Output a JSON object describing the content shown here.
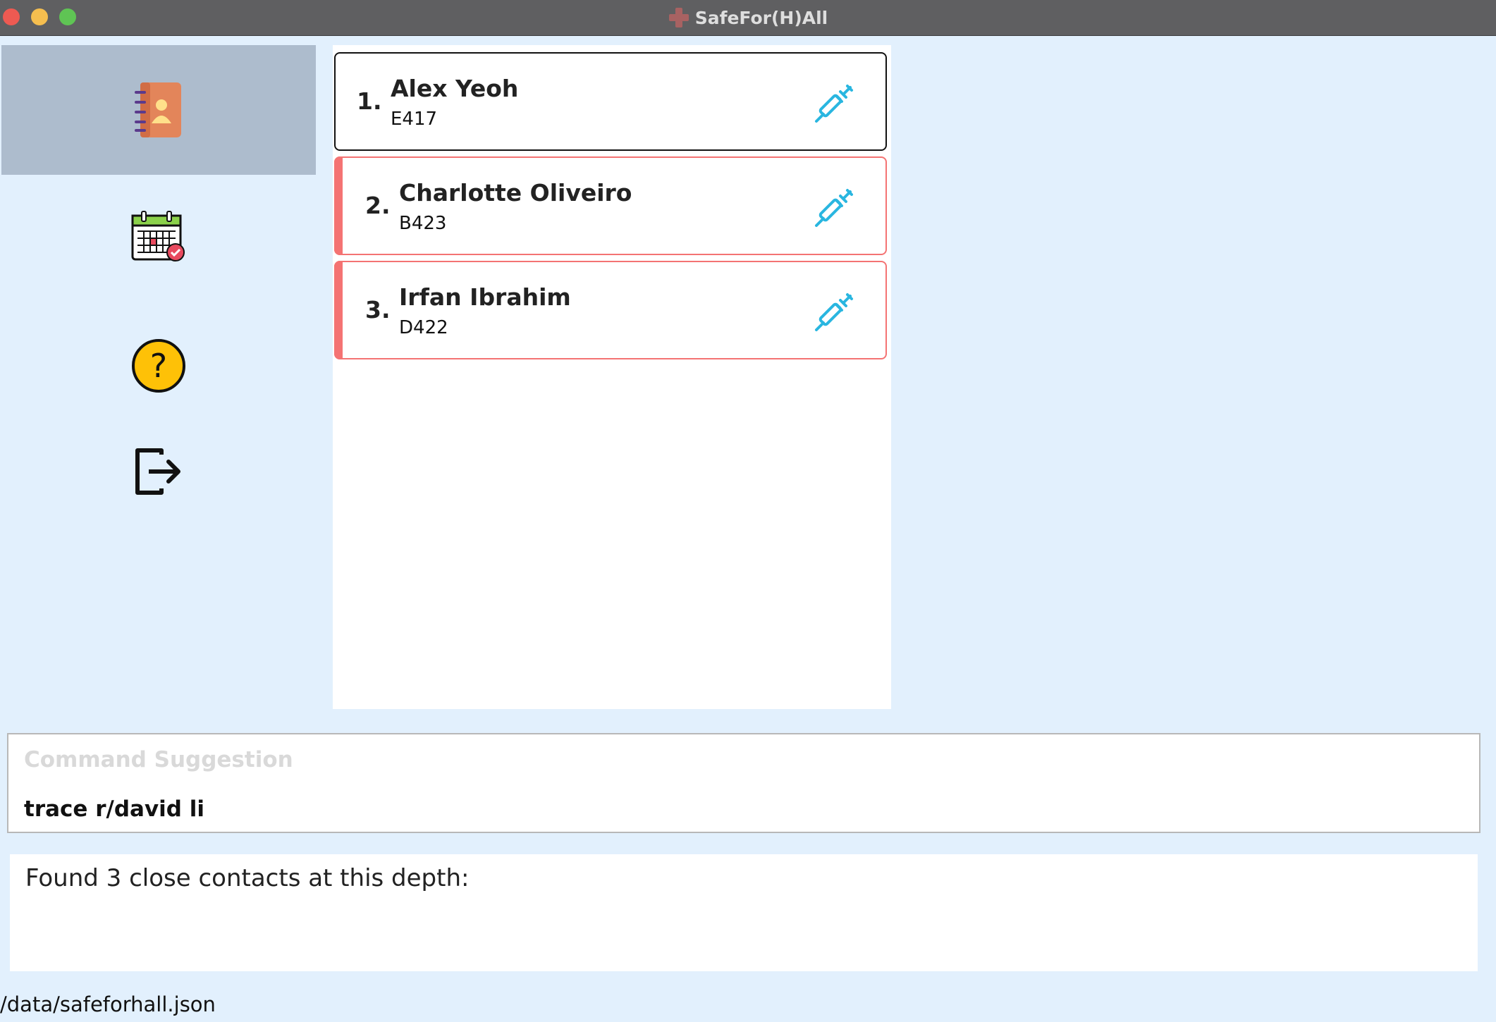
{
  "window": {
    "title": "SafeFor(H)All",
    "logo_icon": "red-cross-icon"
  },
  "sidebar": {
    "items": [
      {
        "icon": "contacts-book-icon",
        "active": true
      },
      {
        "icon": "calendar-check-icon",
        "active": false
      },
      {
        "icon": "help-icon",
        "active": false
      },
      {
        "icon": "exit-icon",
        "active": false
      }
    ]
  },
  "residents": [
    {
      "index": "1.",
      "name": "Alex Yeoh",
      "room": "E417",
      "icon": "syringe-icon",
      "state": "selected"
    },
    {
      "index": "2.",
      "name": "Charlotte Oliveiro",
      "room": "B423",
      "icon": "syringe-icon",
      "state": "flagged"
    },
    {
      "index": "3.",
      "name": "Irfan Ibrahim",
      "room": "D422",
      "icon": "syringe-icon",
      "state": "flagged"
    }
  ],
  "command": {
    "suggestion_label": "Command Suggestion",
    "value": "trace r/david li"
  },
  "result": {
    "message": "Found 3 close contacts at this depth:"
  },
  "status": {
    "file_path": "/data/safeforhall.json"
  },
  "colors": {
    "background": "#e2f0fd",
    "titlebar": "#5f5f61",
    "sidebar_active": "#adbccd",
    "flag_red": "#f47373",
    "syringe_blue": "#29b6e0"
  }
}
